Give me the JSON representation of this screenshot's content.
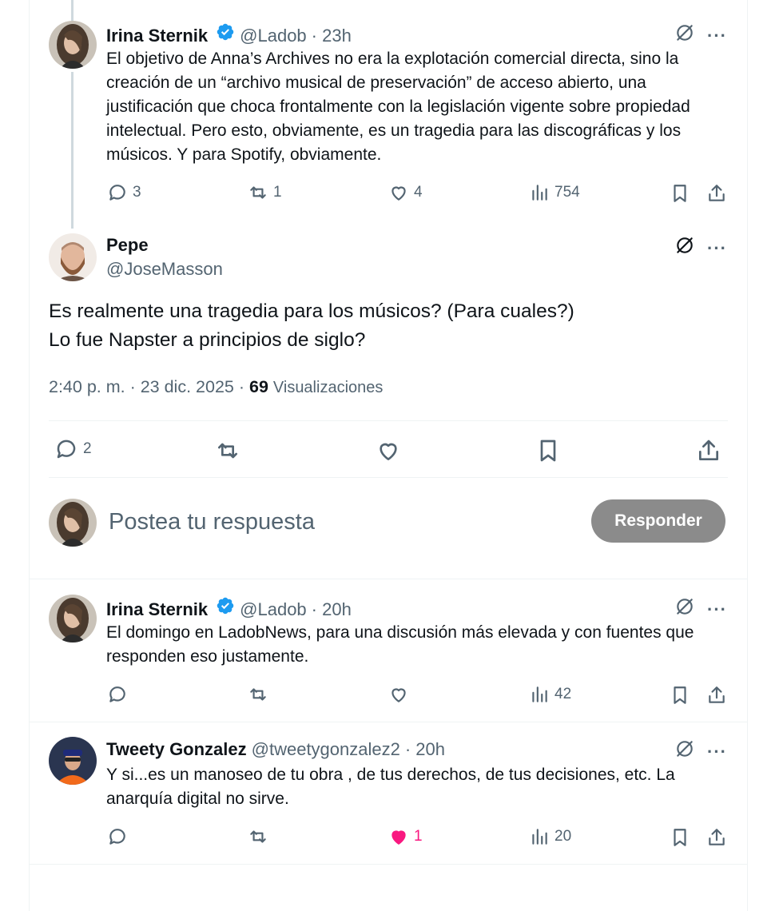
{
  "colors": {
    "verified": "#1d9bf0",
    "like_active": "#f91880",
    "muted": "#536471",
    "reply_button": "#8b8b8b"
  },
  "tweets": [
    {
      "name": "Irina Sternik",
      "verified": true,
      "handle": "@Ladob",
      "time": "· 23h",
      "text": "El objetivo de  Anna’s Archives no era la explotación comercial directa, sino la creación de un “archivo musical de preservación” de acceso abierto, una justificación que choca frontalmente con la legislación vigente sobre propiedad intelectual. Pero esto, obviamente, es un tragedia para las discográficas y los músicos. Y para Spotify, obviamente.",
      "replies": "3",
      "reposts": "1",
      "likes": "4",
      "views": "754"
    },
    {
      "name": "Irina Sternik",
      "verified": true,
      "handle": "@Ladob",
      "time": "· 20h",
      "text": "El domingo en LadobNews, para una discusión más elevada y con fuentes que responden eso justamente.",
      "replies": "",
      "reposts": "",
      "likes": "",
      "views": "42"
    },
    {
      "name": "Tweety Gonzalez",
      "verified": false,
      "handle": "@tweetygonzalez2",
      "time": "· 20h",
      "text": "Y si...es un manoseo de tu obra , de tus derechos, de tus decisiones, etc. La anarquía digital no sirve.",
      "replies": "",
      "reposts": "",
      "likes": "1",
      "views": "20"
    }
  ],
  "main_tweet": {
    "name": "Pepe",
    "handle": "@JoseMasson",
    "text": "Es realmente una tragedia para los músicos? (Para cuales?)\nLo fue Napster a principios de siglo?",
    "timestamp": "2:40 p. m. · 23 dic. 2025 ·",
    "views_count": "69",
    "views_label": "Visualizaciones",
    "replies": "2"
  },
  "reply_box": {
    "placeholder": "Postea tu respuesta",
    "button_label": "Responder"
  },
  "more_label": "···"
}
